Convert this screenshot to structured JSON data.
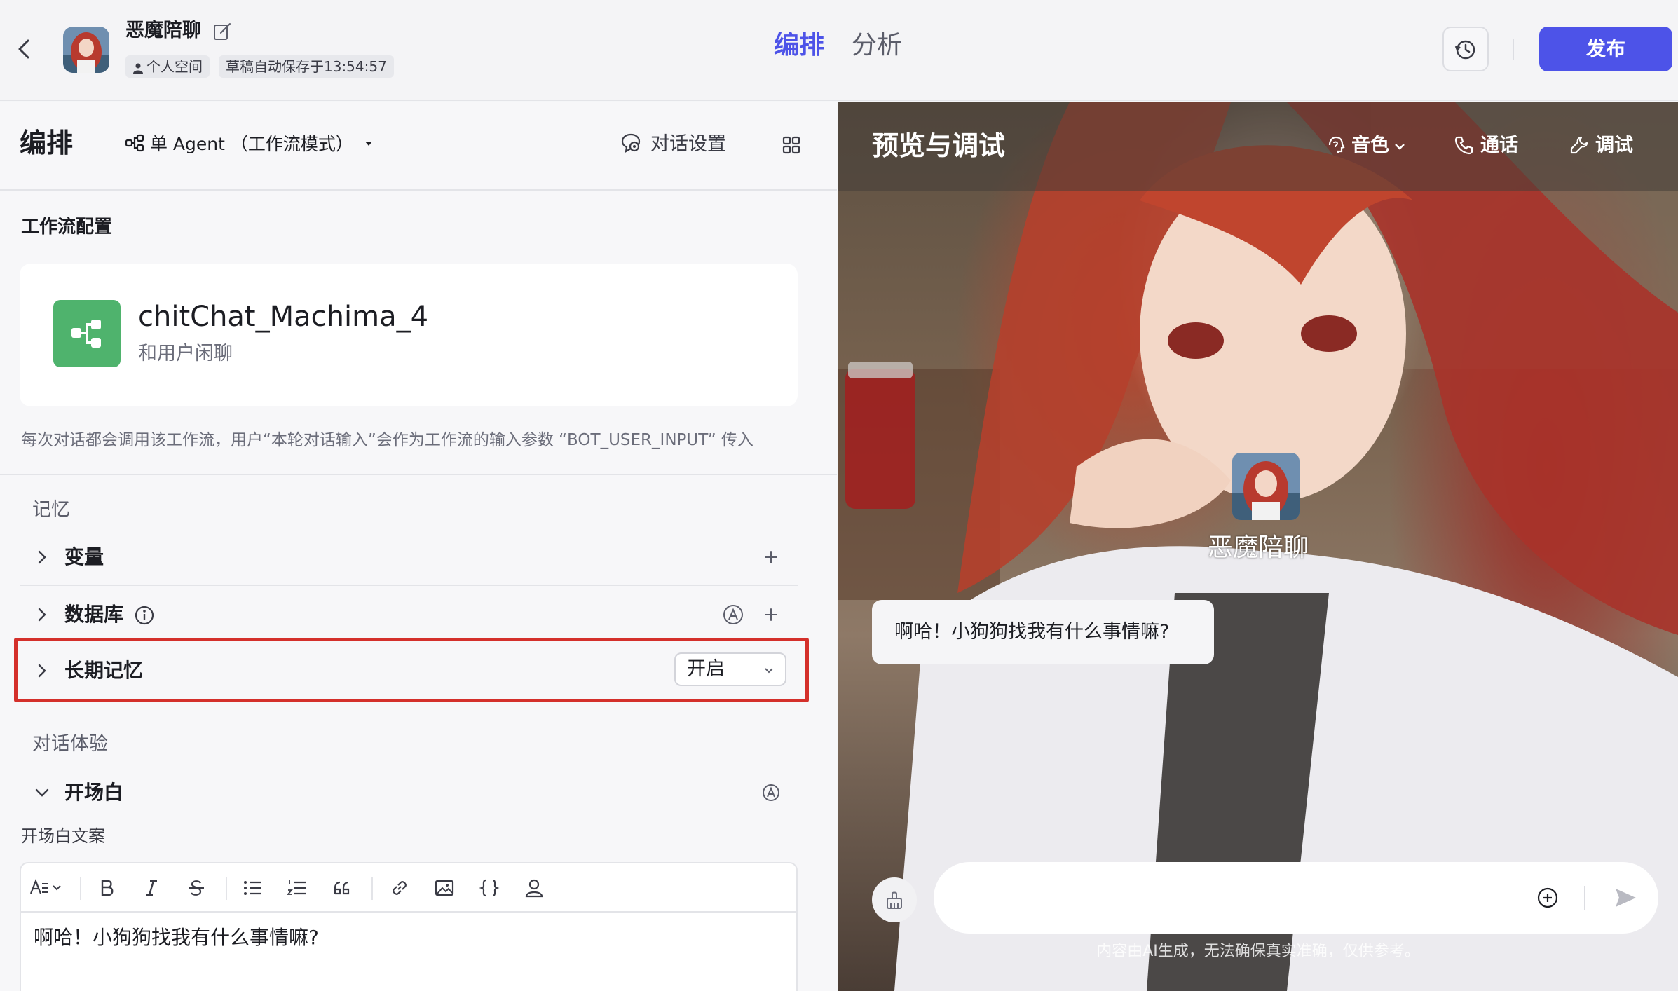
{
  "header": {
    "bot_name": "恶魔陪聊",
    "space_tag": "个人空间",
    "autosave_tag": "草稿自动保存于13:54:57",
    "tabs": [
      {
        "label": "编排",
        "active": true
      },
      {
        "label": "分析",
        "active": false
      }
    ],
    "publish_label": "发布",
    "accent_color": "#4d53e8"
  },
  "left_panel": {
    "title": "编排",
    "mode_select": "单 Agent （工作流模式）",
    "dialog_settings": "对话设置",
    "workflow_section": "工作流配置",
    "workflow": {
      "name": "chitChat_Machima_4",
      "description": "和用户闲聊",
      "icon": "workflow-icon",
      "icon_color": "#4fb36d"
    },
    "workflow_note": "每次对话都会调用该工作流，用户“本轮对话输入”会作为工作流的输入参数 “BOT_USER_INPUT” 传入",
    "memory_group": "记忆",
    "memory_items": {
      "variables": "变量",
      "database": "数据库",
      "long_term_memory": "长期记忆",
      "long_term_memory_value": "开启"
    },
    "experience_group": "对话体验",
    "opening": {
      "title": "开场白",
      "editor_label": "开场白文案",
      "text": "啊哈！小狗狗找我有什么事情嘛?"
    },
    "highlight_color": "#d4302b"
  },
  "right_panel": {
    "title": "预览与调试",
    "voice_label": "音色",
    "call_label": "通话",
    "debug_label": "调试",
    "chat_bot_name": "恶魔陪聊",
    "greeting_bubble": "啊哈！小狗狗找我有什么事情嘛?",
    "input_placeholder": "",
    "disclaimer": "内容由AI生成，无法确保真实准确，仅供参考。"
  }
}
